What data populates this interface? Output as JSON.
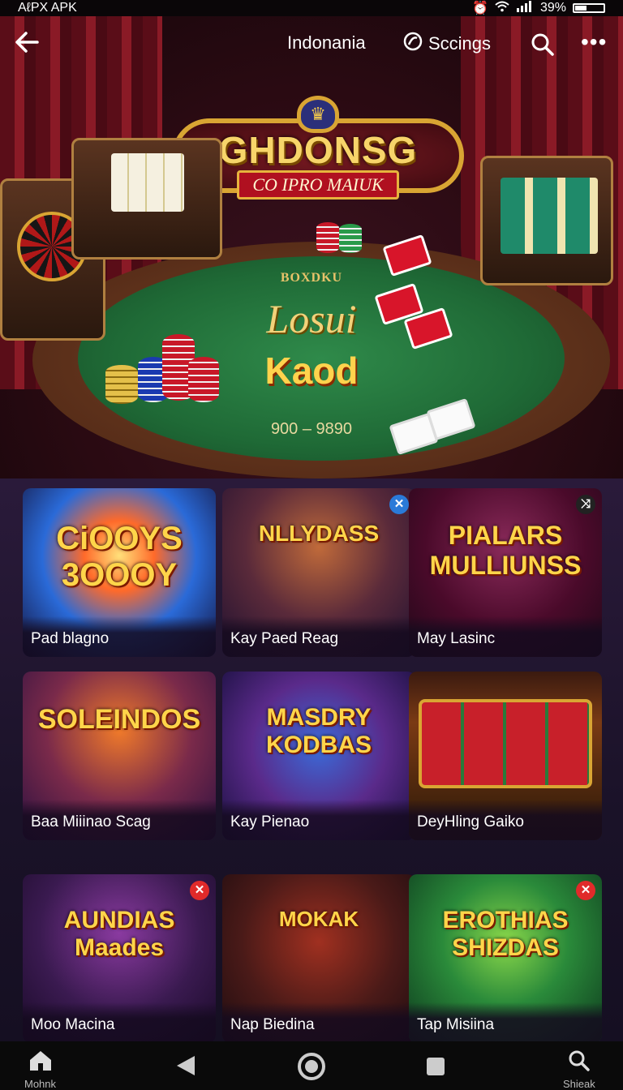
{
  "status_bar": {
    "left_text": "AℓPX APK",
    "battery_text": "39%",
    "battery_level": 0.39
  },
  "top_nav": {
    "language": "Indonania",
    "settings_label": "Sccings",
    "icons": [
      "back-arrow-icon",
      "settings-icon",
      "search-icon",
      "more-icon"
    ]
  },
  "hero": {
    "sign_title": "GHDONSG",
    "sign_ribbon": "CO IPRO MAIUK",
    "felt_top": "BOXDKU",
    "felt_logo": "Losui",
    "felt_sub": "Kaod",
    "felt_range": "900 – 9890"
  },
  "games": [
    {
      "art_title": "CiOOYS 3OOOY",
      "label": "Pad blagno",
      "badge": ""
    },
    {
      "art_title": "NLLYDASS",
      "label": "Kay Paed Reag",
      "badge": "✕"
    },
    {
      "art_title": "PIALARS MULLIUNSS",
      "label": "May Lasinc",
      "badge": "⤨"
    },
    {
      "art_title": "SOLEINDOS",
      "label": "Baa Miiinao Scag",
      "badge": ""
    },
    {
      "art_title": "MASDRY KODBAS",
      "label": "Kay Pienao",
      "badge": ""
    },
    {
      "art_title": "",
      "label": "DeyHling Gaiko",
      "badge": ""
    },
    {
      "art_title": "AUNDIAS Maades",
      "label": "Moo Macina",
      "badge": "✕"
    },
    {
      "art_title": "MOKAK",
      "label": "Nap Biedina",
      "badge": ""
    },
    {
      "art_title": "EROTHIAS SHIZDAS",
      "label": "Tap Misiina",
      "badge": "✕"
    }
  ],
  "bottom_nav": {
    "home_label": "Mohnk",
    "search_label": "Shieak"
  },
  "colors": {
    "accent_gold": "#f2c94c",
    "felt_green": "#1f6a36",
    "badge_blue": "#2a7ad8",
    "badge_red": "#e02a2a"
  }
}
